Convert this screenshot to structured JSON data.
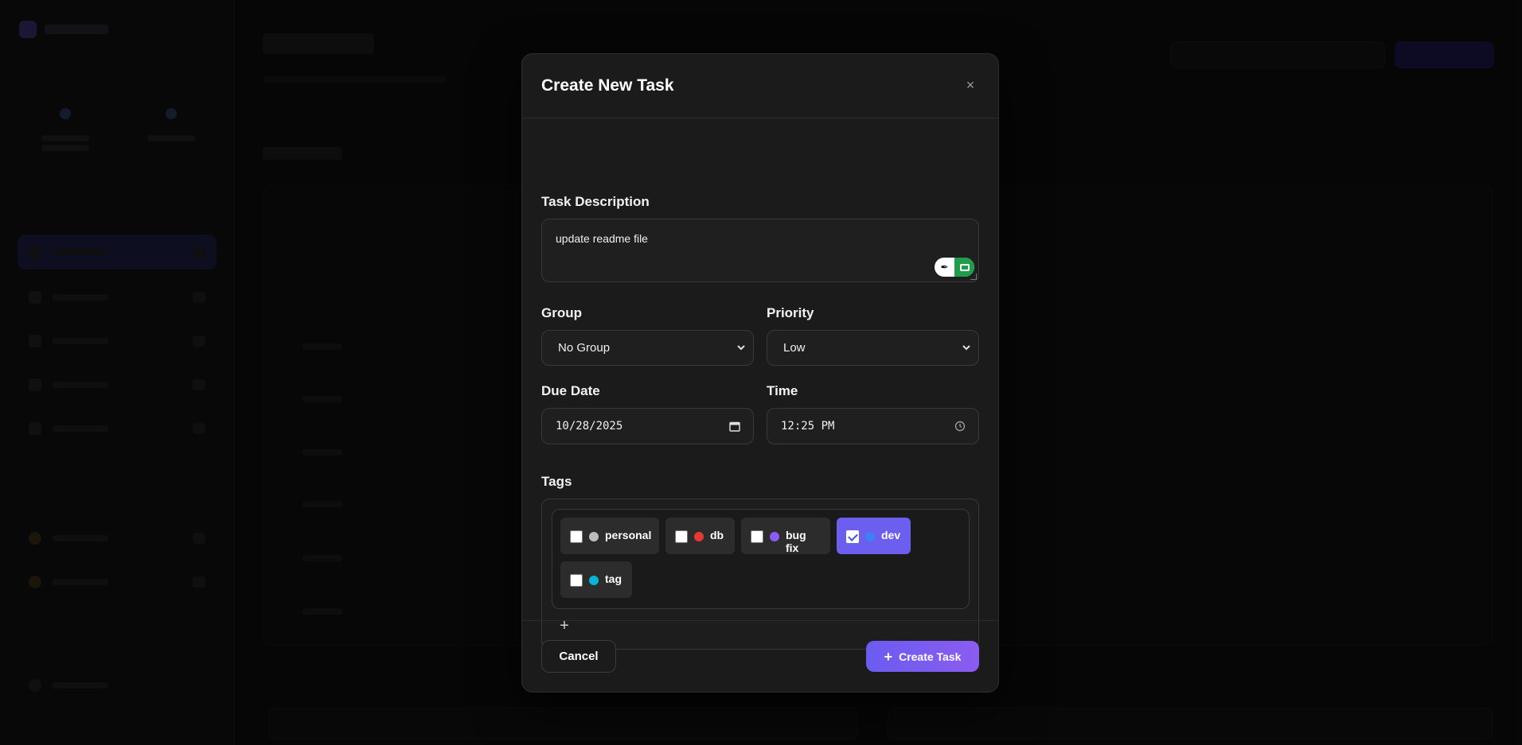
{
  "modal": {
    "title": "Create New Task",
    "close_symbol": "×"
  },
  "form": {
    "description_label": "Task Description",
    "description_value": "update readme file",
    "group_label": "Group",
    "group_value": "No Group",
    "priority_label": "Priority",
    "priority_value": "Low",
    "due_date_label": "Due Date",
    "due_date_value": "10/28/2025",
    "time_label": "Time",
    "time_value": "12:25 PM",
    "tags_label": "Tags",
    "add_tag_symbol": "+"
  },
  "tags": [
    {
      "name": "personal",
      "color": "#bdbdbd",
      "checked": false
    },
    {
      "name": "db",
      "color": "#e53935",
      "checked": false
    },
    {
      "name": "bug fix",
      "color": "#8b5cf6",
      "checked": false
    },
    {
      "name": "dev",
      "color": "#3b82f6",
      "checked": true
    },
    {
      "name": "tag",
      "color": "#06b6d4",
      "checked": false
    }
  ],
  "footer": {
    "cancel_label": "Cancel",
    "create_label": "Create Task",
    "create_icon": "plus-icon"
  },
  "colors": {
    "accent": "#6c5ff0",
    "modal_bg": "#1b1b1b"
  }
}
